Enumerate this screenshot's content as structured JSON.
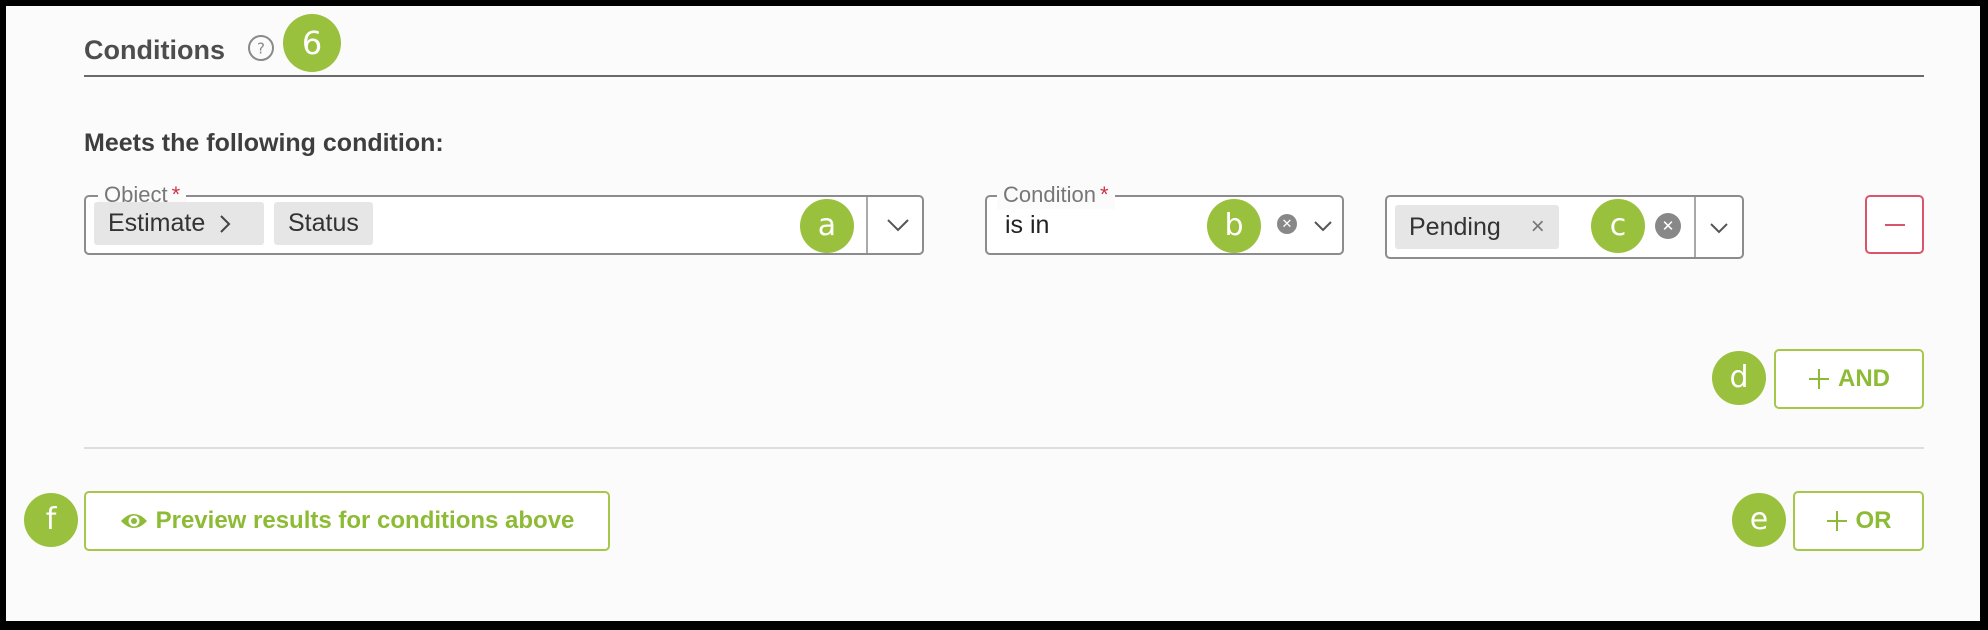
{
  "section": {
    "title": "Conditions",
    "step_marker": "6",
    "subtitle": "Meets the following condition:"
  },
  "object_field": {
    "label": "Object",
    "required_mark": "*",
    "chips": [
      "Estimate",
      "Status"
    ],
    "marker": "a"
  },
  "condition_field": {
    "label": "Condition",
    "required_mark": "*",
    "value": "is in",
    "marker": "b"
  },
  "value_field": {
    "chip": "Pending",
    "chip_remove": "×",
    "marker": "c"
  },
  "and_button": {
    "label": "AND",
    "marker": "d"
  },
  "or_button": {
    "label": "OR",
    "marker": "e"
  },
  "preview_button": {
    "label": "Preview results for conditions above",
    "marker": "f"
  },
  "colors": {
    "accent_green": "#8ebb35",
    "marker_green": "#99c13d",
    "danger_red": "#d9566a"
  },
  "icons": [
    "help-icon",
    "chevron-right-icon",
    "chevron-down-icon",
    "clear-icon",
    "minus-icon",
    "plus-icon",
    "eye-icon"
  ]
}
